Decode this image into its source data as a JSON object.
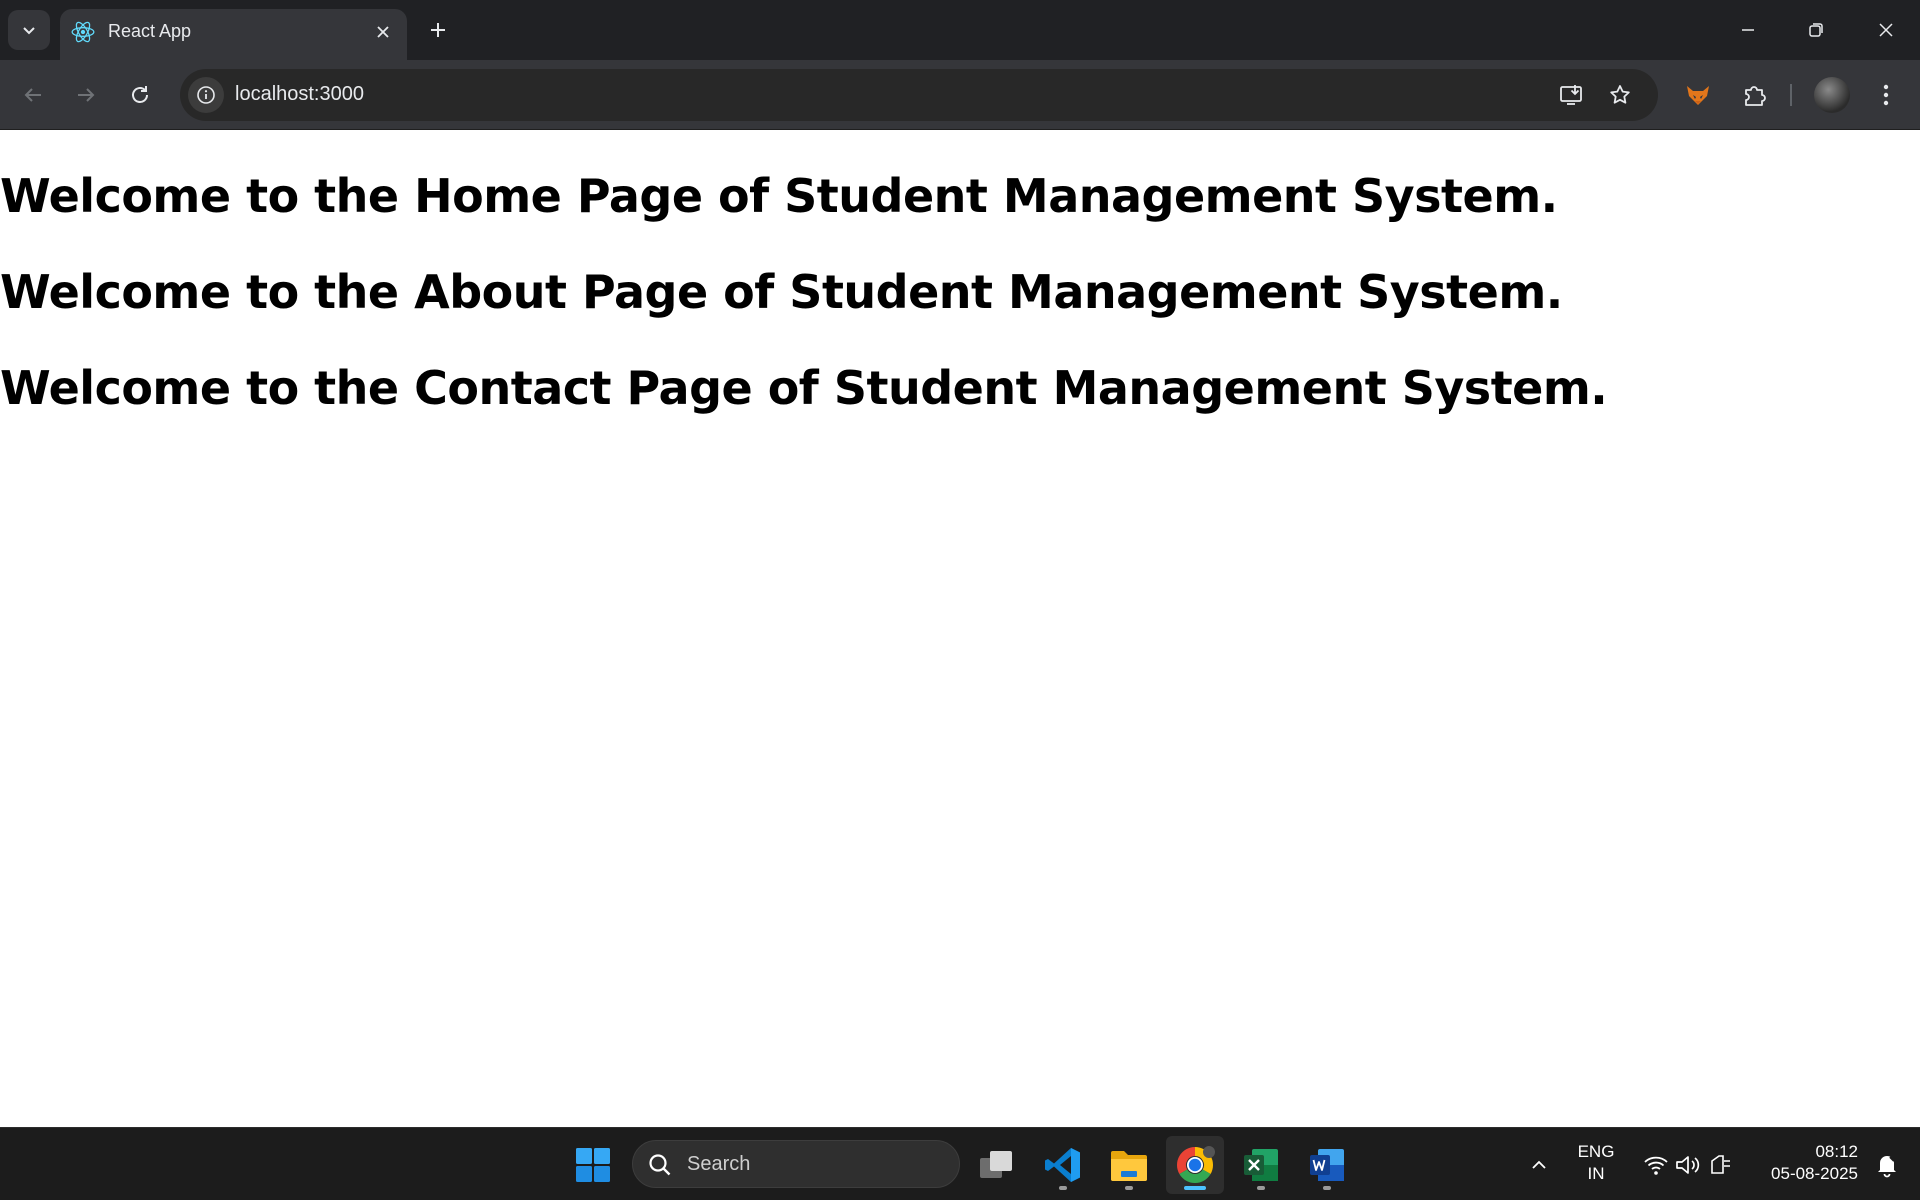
{
  "browser": {
    "tab": {
      "title": "React App",
      "favicon": "react-icon"
    },
    "address": {
      "url": "localhost:3000"
    },
    "icons": {
      "back": "back-arrow-icon",
      "forward": "forward-arrow-icon",
      "reload": "reload-icon",
      "install": "install-app-icon",
      "bookmark": "star-icon",
      "extension_fox": "fox-extension-icon",
      "extensions": "puzzle-icon",
      "menu": "kebab-menu-icon"
    }
  },
  "page": {
    "headings": [
      "Welcome to the Home Page of Student Management System.",
      "Welcome to the About Page of Student Management System.",
      "Welcome to the Contact Page of Student Management System."
    ]
  },
  "taskbar": {
    "search_placeholder": "Search",
    "apps": [
      "start",
      "task-view",
      "vscode",
      "file-explorer",
      "chrome",
      "excel",
      "word"
    ],
    "language": {
      "line1": "ENG",
      "line2": "IN"
    },
    "clock": {
      "time": "08:12",
      "date": "05-08-2025"
    }
  },
  "colors": {
    "tabstrip": "#202124",
    "toolbar": "#35363a",
    "taskbar": "#1c1c1c",
    "accent": "#4cc2ff"
  }
}
